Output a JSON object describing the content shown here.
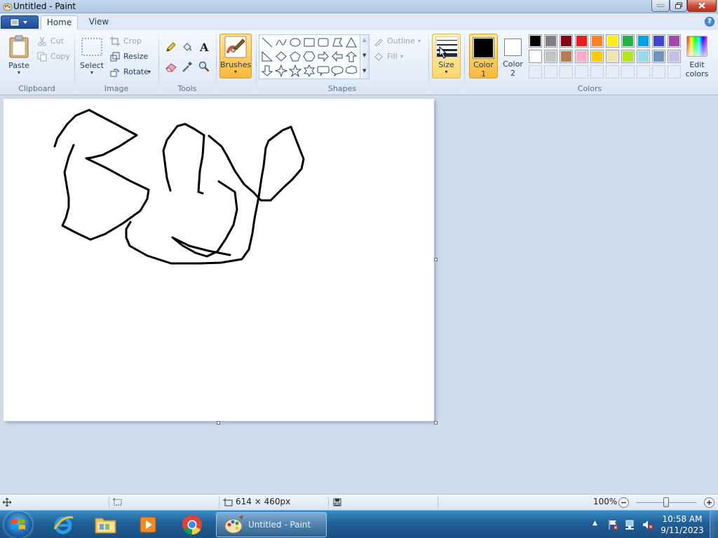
{
  "window": {
    "title": "Untitled - Paint"
  },
  "tabs": {
    "home": "Home",
    "view": "View",
    "help": "?"
  },
  "ribbon": {
    "clipboard": {
      "group_label": "Clipboard",
      "paste": "Paste",
      "cut": "Cut",
      "copy": "Copy"
    },
    "image": {
      "group_label": "Image",
      "select": "Select",
      "crop": "Crop",
      "resize": "Resize",
      "rotate": "Rotate"
    },
    "tools": {
      "group_label": "Tools"
    },
    "brushes": {
      "label": "Brushes"
    },
    "shapes": {
      "group_label": "Shapes",
      "outline": "Outline",
      "fill": "Fill"
    },
    "size": {
      "label": "Size"
    },
    "color1": {
      "label_line1": "Color",
      "label_line2": "1",
      "value": "#000000"
    },
    "color2": {
      "label_line1": "Color",
      "label_line2": "2",
      "value": "#ffffff"
    },
    "colors": {
      "group_label": "Colors",
      "edit_line1": "Edit",
      "edit_line2": "colors",
      "row1": [
        "#000000",
        "#7f7f7f",
        "#880015",
        "#ed1c24",
        "#ff7f27",
        "#fff200",
        "#22b14c",
        "#00a2e8",
        "#3f48cc",
        "#a349a4"
      ],
      "row2": [
        "#ffffff",
        "#c3c3c3",
        "#b97a57",
        "#ffaec9",
        "#ffc90e",
        "#efe4b0",
        "#b5e61d",
        "#99d9ea",
        "#7092be",
        "#c8bfe7"
      ]
    }
  },
  "statusbar": {
    "dimensions": "614 × 460px",
    "zoom": "100%"
  },
  "taskbar": {
    "active_app": "Untitled - Paint",
    "time": "10:58 AM",
    "date": "9/11/2023"
  }
}
